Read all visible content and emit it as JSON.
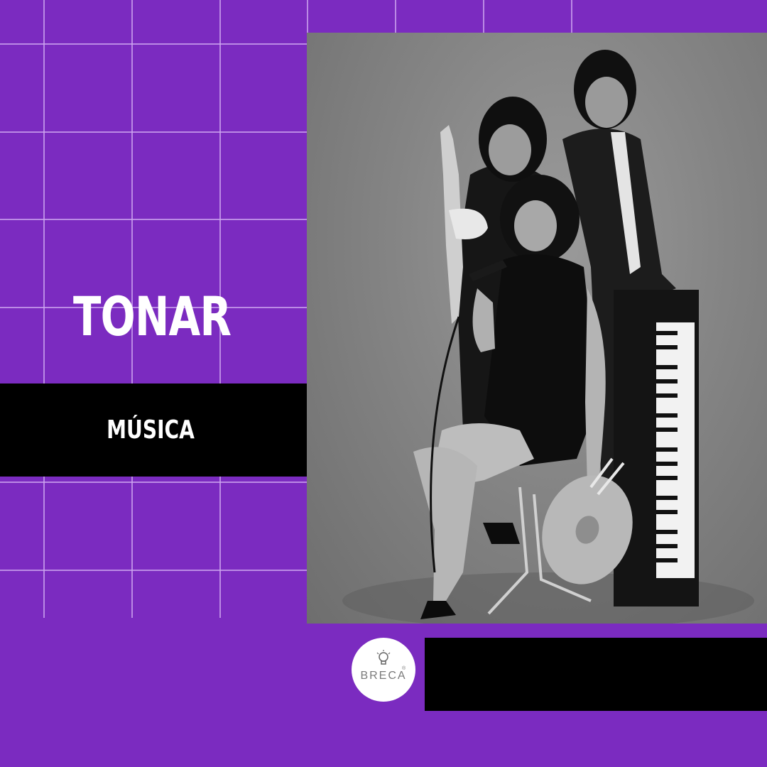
{
  "title": "TONAR",
  "category": "MÚSICA",
  "logo": {
    "name": "BRECA",
    "registered_mark": "®"
  },
  "colors": {
    "background": "#7b2bc0",
    "band": "#000000",
    "text": "#ffffff"
  },
  "photo": {
    "subject": "band-portrait"
  }
}
